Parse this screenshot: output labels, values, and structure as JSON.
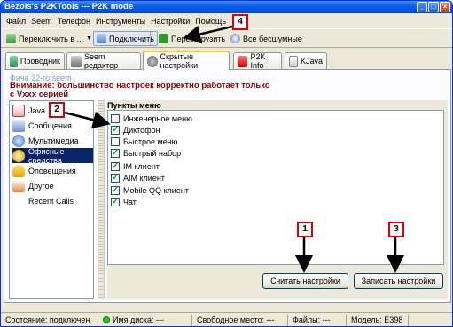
{
  "window": {
    "title": "Bezols's P2KTools --- P2K mode",
    "minimize": "_",
    "maximize": "□",
    "close": "×"
  },
  "menu": [
    "Файл",
    "Seem",
    "Телефон",
    "Инструменты",
    "Настройки",
    "Помощь"
  ],
  "toolbar": {
    "switch_label": "Переключить в ...",
    "connect_label": "Подключить",
    "reboot_label": "Перезагрузить",
    "all_silent_label": "Все бесшумные"
  },
  "tabs": [
    "Проводник",
    "Seem редактор",
    "Скрытые настройки",
    "P2K Info",
    "KJava"
  ],
  "phone_note": "Фича 32-го seem",
  "warning": "Внимание: большинство настроек корректно работает только с Vxxx серией",
  "categories": [
    "Java",
    "Сообщения",
    "Мультимедиа",
    "Офисные средства",
    "Оповещения",
    "Другое",
    "Recent Calls"
  ],
  "selected_category": 3,
  "menu_header": "Пункты меню",
  "items": [
    {
      "label": "Инженерное меню",
      "checked": false
    },
    {
      "label": "Диктофон",
      "checked": true
    },
    {
      "label": "Быстрое меню",
      "checked": false
    },
    {
      "label": "Быстрый набор",
      "checked": true
    },
    {
      "label": "IM клиент",
      "checked": true
    },
    {
      "label": "AIM клиент",
      "checked": true
    },
    {
      "label": "Mobile QQ клиент",
      "checked": true
    },
    {
      "label": "Чат",
      "checked": true
    }
  ],
  "buttons": {
    "read": "Считать настройки",
    "write": "Записать настройки"
  },
  "status": {
    "state": "Состояние: подключен",
    "disk": "Имя диска: ---",
    "free": "Свободное место: ---",
    "files": "Файлы: ---",
    "model": "Модель: E398"
  },
  "callouts": [
    "1",
    "2",
    "3",
    "4"
  ],
  "colors": {
    "title_blue": "#0a5ee8",
    "warning": "#8b0000",
    "selection": "#0a246a",
    "callout_red": "#e00000"
  }
}
